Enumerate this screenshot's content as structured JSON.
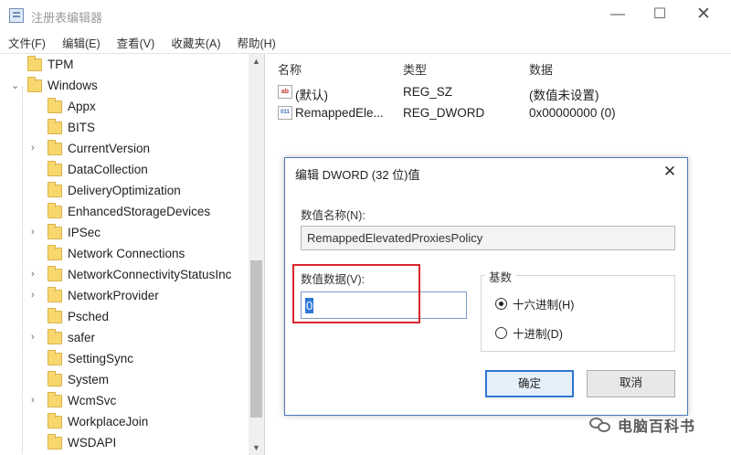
{
  "window": {
    "title": "注册表编辑器",
    "min_glyph": "—",
    "max_glyph": "☐",
    "close_glyph": "✕"
  },
  "menu": [
    "文件(F)",
    "编辑(E)",
    "查看(V)",
    "收藏夹(A)",
    "帮助(H)"
  ],
  "tree": {
    "items": [
      {
        "label": "TPM",
        "expander": "",
        "selected": false
      },
      {
        "label": "Windows",
        "expander": "⌄",
        "selected": false
      },
      {
        "label": "Appx",
        "expander": "",
        "selected": false
      },
      {
        "label": "BITS",
        "expander": "",
        "selected": false
      },
      {
        "label": "CurrentVersion",
        "expander": "›",
        "selected": false
      },
      {
        "label": "DataCollection",
        "expander": "",
        "selected": false
      },
      {
        "label": "DeliveryOptimization",
        "expander": "",
        "selected": false
      },
      {
        "label": "EnhancedStorageDevices",
        "expander": "",
        "selected": false
      },
      {
        "label": "IPSec",
        "expander": "›",
        "selected": false
      },
      {
        "label": "Network Connections",
        "expander": "",
        "selected": false
      },
      {
        "label": "NetworkConnectivityStatusInc",
        "expander": "›",
        "selected": false
      },
      {
        "label": "NetworkProvider",
        "expander": "›",
        "selected": false
      },
      {
        "label": "Psched",
        "expander": "",
        "selected": false
      },
      {
        "label": "safer",
        "expander": "›",
        "selected": false
      },
      {
        "label": "SettingSync",
        "expander": "",
        "selected": false
      },
      {
        "label": "System",
        "expander": "",
        "selected": false
      },
      {
        "label": "WcmSvc",
        "expander": "›",
        "selected": false
      },
      {
        "label": "WorkplaceJoin",
        "expander": "",
        "selected": false
      },
      {
        "label": "WSDAPI",
        "expander": "",
        "selected": false
      }
    ]
  },
  "list": {
    "headers": {
      "name": "名称",
      "type": "类型",
      "data": "数据"
    },
    "rows": [
      {
        "icon": "ab",
        "name": "(默认)",
        "type": "REG_SZ",
        "data": "(数值未设置)"
      },
      {
        "icon": "bin",
        "name": "RemappedEle...",
        "type": "REG_DWORD",
        "data": "0x00000000 (0)"
      }
    ]
  },
  "dialog": {
    "title": "编辑 DWORD (32 位)值",
    "close_glyph": "✕",
    "name_label": "数值名称(N):",
    "name_value": "RemappedElevatedProxiesPolicy",
    "data_label": "数值数据(V):",
    "data_value": "0",
    "base_label": "基数",
    "hex_label": "十六进制(H)",
    "dec_label": "十进制(D)",
    "ok_label": "确定",
    "cancel_label": "取消",
    "selected_base": "hex",
    "highlight_color": "#d6262d"
  },
  "watermark": {
    "text": "电脑百科书"
  }
}
